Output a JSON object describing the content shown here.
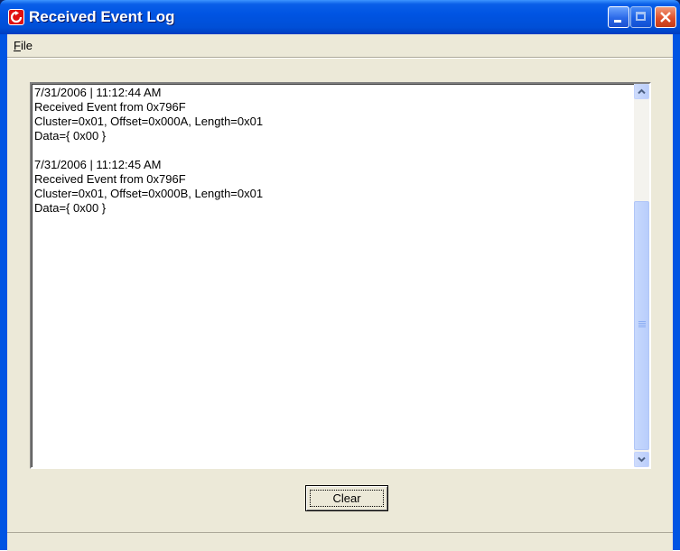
{
  "window": {
    "title": "Received Event Log"
  },
  "menu": {
    "file": "File"
  },
  "log": {
    "entries": [
      {
        "timestamp": "7/31/2006 | 11:12:44 AM",
        "source": "Received Event from 0x796F",
        "details": "Cluster=0x01, Offset=0x000A, Length=0x01",
        "data": "Data={ 0x00 }"
      },
      {
        "timestamp": "7/31/2006 | 11:12:45 AM",
        "source": "Received Event from 0x796F",
        "details": "Cluster=0x01, Offset=0x000B, Length=0x01",
        "data": "Data={ 0x00 }"
      }
    ]
  },
  "buttons": {
    "clear": "Clear"
  },
  "colors": {
    "titlebar": "#0054e3",
    "client_background": "#ece9d8",
    "log_background": "#ffffff",
    "close_button": "#e0502c"
  },
  "icons": {
    "app": "red-circular-arrow-icon",
    "minimize": "minimize-icon",
    "maximize": "maximize-icon",
    "close": "close-icon",
    "scroll_up": "chevron-up-icon",
    "scroll_down": "chevron-down-icon"
  }
}
